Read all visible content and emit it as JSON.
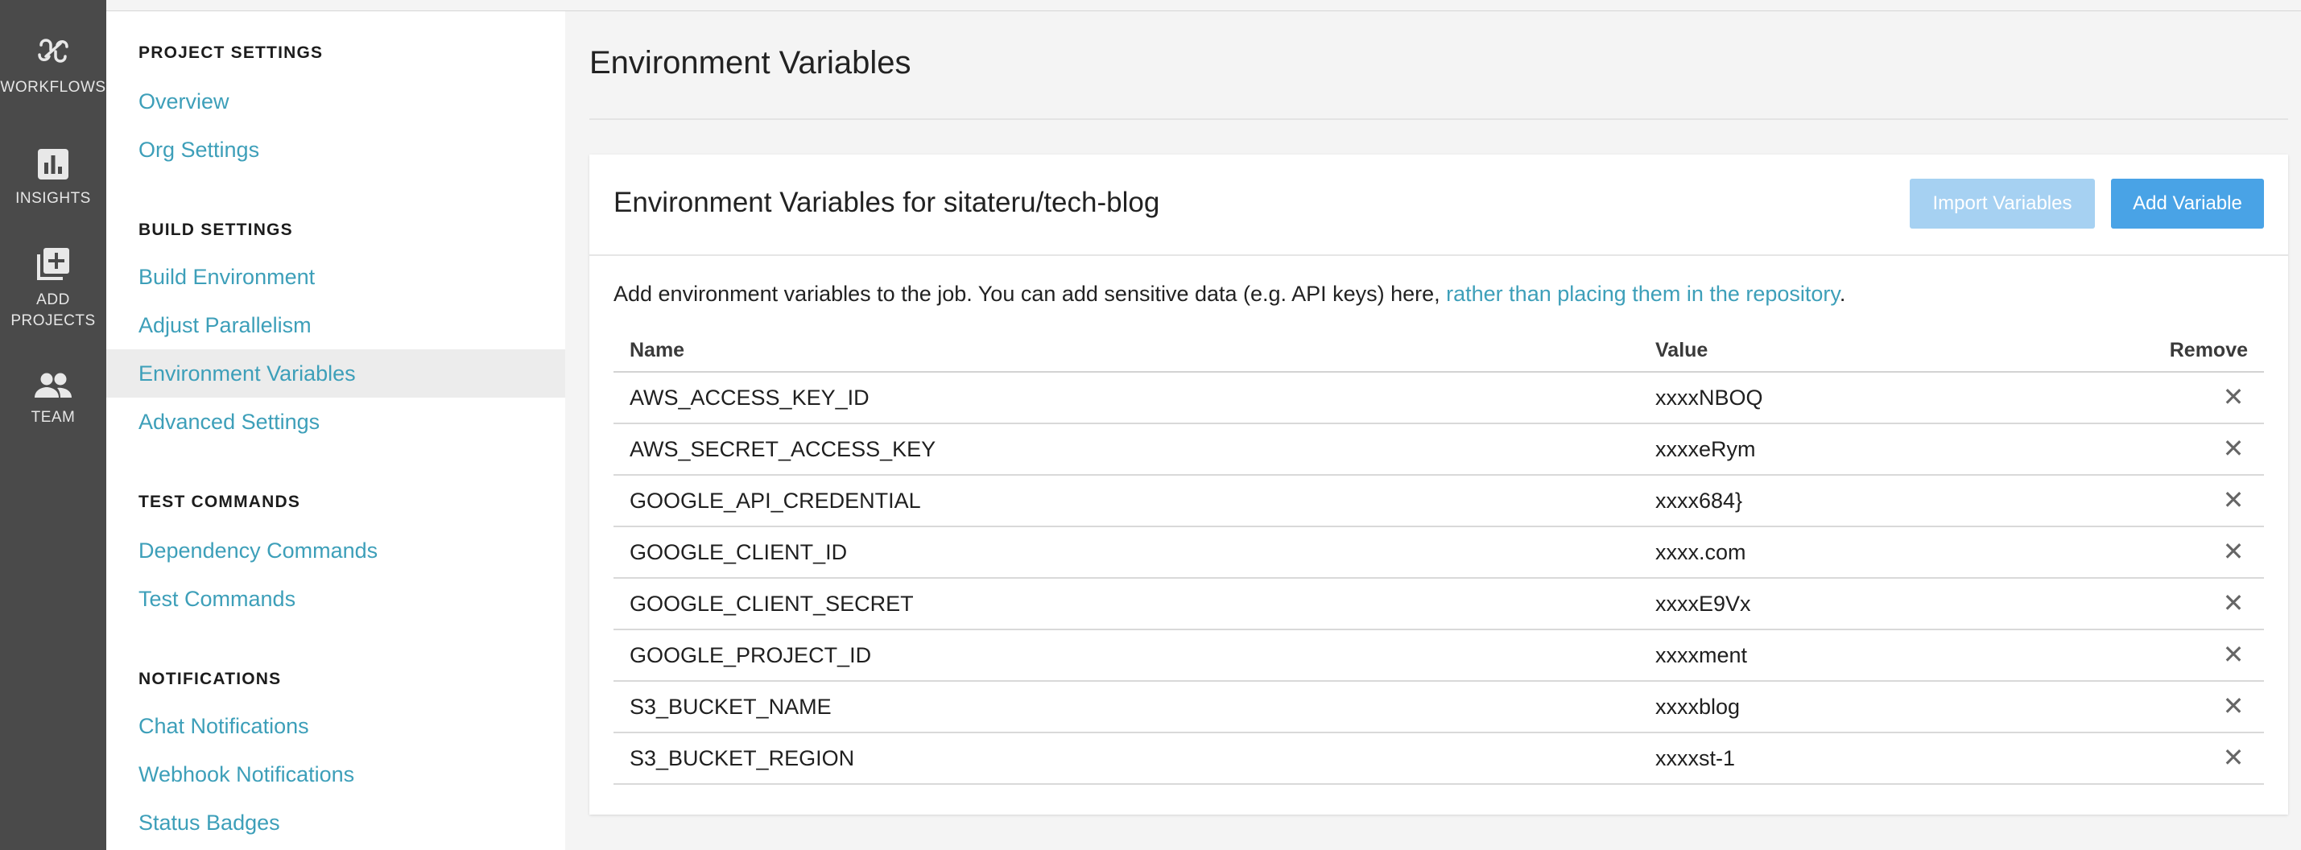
{
  "rail": {
    "items": [
      {
        "label": "WORKFLOWS",
        "icon": "workflows-icon"
      },
      {
        "label": "INSIGHTS",
        "icon": "insights-icon"
      },
      {
        "label_line1": "ADD",
        "label_line2": "PROJECTS",
        "icon": "add-projects-icon"
      },
      {
        "label": "TEAM",
        "icon": "team-icon"
      }
    ]
  },
  "sidebar": {
    "project_settings": {
      "heading": "PROJECT SETTINGS",
      "links": [
        "Overview",
        "Org Settings"
      ]
    },
    "build_settings": {
      "heading": "BUILD SETTINGS",
      "links": [
        "Build Environment",
        "Adjust Parallelism",
        "Environment Variables",
        "Advanced Settings"
      ]
    },
    "test_commands": {
      "heading": "TEST COMMANDS",
      "links": [
        "Dependency Commands",
        "Test Commands"
      ]
    },
    "notifications": {
      "heading": "NOTIFICATIONS",
      "links": [
        "Chat Notifications",
        "Webhook Notifications",
        "Status Badges"
      ]
    },
    "active_link": "Environment Variables"
  },
  "main": {
    "page_title": "Environment Variables",
    "card": {
      "title": "Environment Variables for sitateru/tech-blog",
      "import_button": "Import Variables",
      "add_button": "Add Variable",
      "description_text": "Add environment variables to the job. You can add sensitive data (e.g. API keys) here, ",
      "description_link": "rather than placing them in the repository",
      "description_end": ".",
      "table": {
        "headers": {
          "name": "Name",
          "value": "Value",
          "remove": "Remove"
        },
        "rows": [
          {
            "name": "AWS_ACCESS_KEY_ID",
            "value": "xxxxNBOQ",
            "remove": "✕"
          },
          {
            "name": "AWS_SECRET_ACCESS_KEY",
            "value": "xxxxeRym",
            "remove": "✕"
          },
          {
            "name": "GOOGLE_API_CREDENTIAL",
            "value": "xxxx684}",
            "remove": "✕"
          },
          {
            "name": "GOOGLE_CLIENT_ID",
            "value": "xxxx.com",
            "remove": "✕"
          },
          {
            "name": "GOOGLE_CLIENT_SECRET",
            "value": "xxxxE9Vx",
            "remove": "✕"
          },
          {
            "name": "GOOGLE_PROJECT_ID",
            "value": "xxxxment",
            "remove": "✕"
          },
          {
            "name": "S3_BUCKET_NAME",
            "value": "xxxxblog",
            "remove": "✕"
          },
          {
            "name": "S3_BUCKET_REGION",
            "value": "xxxxst-1",
            "remove": "✕"
          }
        ]
      }
    }
  },
  "colors": {
    "rail_bg": "#4a4a4a",
    "link": "#3d9fb9",
    "primary_button": "#49a3e6",
    "disabled_button": "#a6d1f2"
  }
}
